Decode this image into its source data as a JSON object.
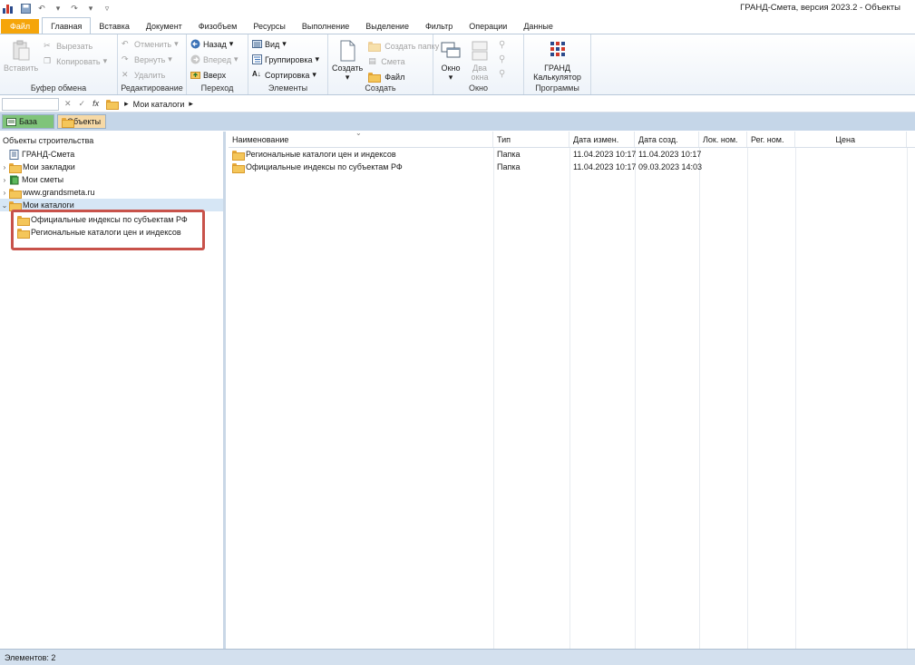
{
  "window": {
    "title": "ГРАНД-Смета, версия 2023.2 - Объекты"
  },
  "ribbon_tabs": [
    "Файл",
    "Главная",
    "Вставка",
    "Документ",
    "Физобъем",
    "Ресурсы",
    "Выполнение",
    "Выделение",
    "Фильтр",
    "Операции",
    "Данные"
  ],
  "ribbon": {
    "clipboard": {
      "paste": "Вставить",
      "cut": "Вырезать",
      "copy": "Копировать",
      "label": "Буфер обмена"
    },
    "editing": {
      "undo": "Отменить",
      "redo": "Вернуть",
      "delete": "Удалить",
      "label": "Редактирование"
    },
    "navigation": {
      "back": "Назад",
      "forward": "Вперед",
      "up": "Вверх",
      "label": "Переход"
    },
    "elements": {
      "view": "Вид",
      "grouping": "Группировка",
      "sorting": "Сортировка",
      "label": "Элементы"
    },
    "create": {
      "create": "Создать",
      "new_folder": "Создать папку",
      "estimate": "Смета",
      "file": "Файл",
      "label": "Создать"
    },
    "window": {
      "window": "Окно",
      "two_windows_1": "Два",
      "two_windows_2": "окна",
      "label": "Окно"
    },
    "programs": {
      "calc_1": "ГРАНД",
      "calc_2": "Калькулятор",
      "label": "Программы"
    }
  },
  "formula_bar": {
    "breadcrumb": "Мои каталоги"
  },
  "doc_tabs": {
    "base": "База",
    "objects": "Объекты"
  },
  "left_pane": {
    "title": "Объекты строительства",
    "tree": [
      {
        "label": "ГРАНД-Смета",
        "icon": "grand-smeta-icon"
      },
      {
        "label": "Мои закладки",
        "icon": "folder-icon"
      },
      {
        "label": "Мои сметы",
        "icon": "my-estimates-icon"
      },
      {
        "label": "www.grandsmeta.ru",
        "icon": "folder-icon"
      },
      {
        "label": "Мои каталоги",
        "icon": "folder-icon"
      }
    ],
    "children": [
      {
        "label": "Официальные индексы по субъектам РФ"
      },
      {
        "label": "Региональные каталоги цен и индексов"
      }
    ]
  },
  "grid": {
    "columns": [
      "Наименование",
      "Тип",
      "Дата измен.",
      "Дата созд.",
      "Лок. ном.",
      "Рег. ном.",
      "Цена"
    ],
    "rows": [
      {
        "name": "Региональные каталоги цен и индексов",
        "type": "Папка",
        "modified": "11.04.2023 10:17",
        "created": "11.04.2023 10:17"
      },
      {
        "name": "Официальные индексы по субъектам РФ",
        "type": "Папка",
        "modified": "11.04.2023 10:17",
        "created": "09.03.2023 14:03"
      }
    ]
  },
  "status": {
    "count": "Элементов: 2"
  },
  "colors": {
    "file_tab": "#f5a50a",
    "callout": "#c8524a",
    "base_tab": "#7fc47a",
    "objects_tab": "#f6d9a6"
  }
}
